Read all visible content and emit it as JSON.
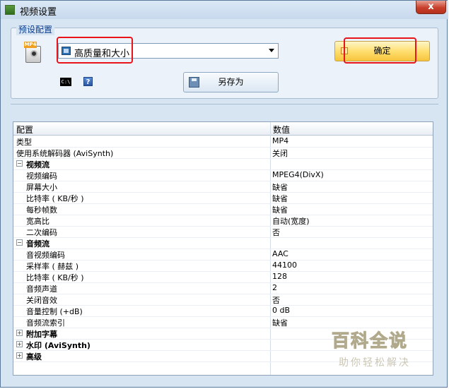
{
  "window": {
    "title": "视频设置",
    "close_label": "x"
  },
  "presets": {
    "legend": "预设配置",
    "selected": "高质量和大小",
    "ok_label": "确定",
    "saveas_label": "另存为",
    "cmd_label": "C:\\",
    "help_label": "?",
    "format_tag": "MP4"
  },
  "grid": {
    "header_setting": "配置",
    "header_value": "数值",
    "rows": [
      {
        "label": "类型",
        "value": "MP4"
      },
      {
        "label": "使用系统解码器 (AviSynth)",
        "value": "关闭"
      },
      {
        "label": "视频流",
        "value": "",
        "category": true
      },
      {
        "label": "视频编码",
        "value": "MPEG4(DivX)"
      },
      {
        "label": "屏幕大小",
        "value": "缺省"
      },
      {
        "label": "比特率 ( KB/秒 )",
        "value": "缺省"
      },
      {
        "label": "每秒帧数",
        "value": "缺省"
      },
      {
        "label": "宽高比",
        "value": "自动(宽度)"
      },
      {
        "label": "二次编码",
        "value": "否"
      },
      {
        "label": "音频流",
        "value": "",
        "category": true
      },
      {
        "label": "音视频编码",
        "value": "AAC"
      },
      {
        "label": "采样率 ( 赫兹 )",
        "value": "44100"
      },
      {
        "label": "比特率 ( KB/秒 )",
        "value": "128"
      },
      {
        "label": "音频声道",
        "value": "2"
      },
      {
        "label": "关闭音效",
        "value": "否"
      },
      {
        "label": "音量控制 (+dB)",
        "value": "0 dB"
      },
      {
        "label": "音频流索引",
        "value": "缺省"
      },
      {
        "label": "附加字幕",
        "value": "",
        "category": true
      },
      {
        "label": "水印 (AviSynth)",
        "value": "",
        "category": true
      },
      {
        "label": "高级",
        "value": "",
        "category": true
      }
    ]
  },
  "watermark": {
    "main": "百科全说",
    "sub": "助你轻松解决"
  },
  "colors": {
    "annotation": "#e8141a",
    "ok_button": "#ffdf70",
    "window_bg": "#d7e4f2"
  }
}
